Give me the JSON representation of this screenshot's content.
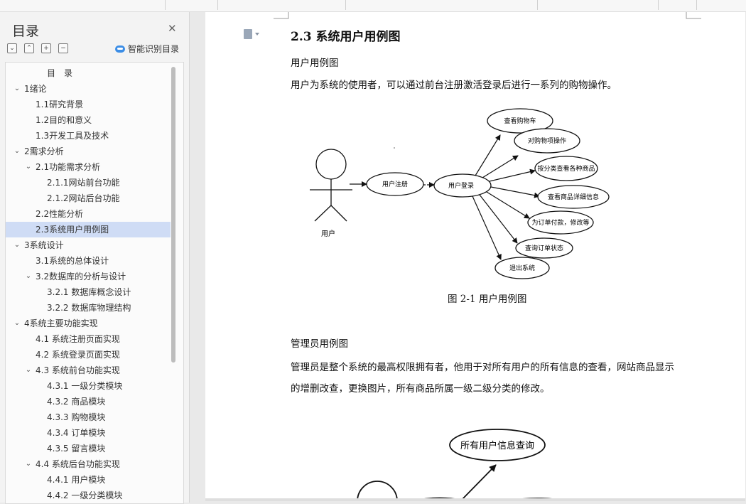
{
  "nav": {
    "title": "目录",
    "smart_toc_label": "智能识别目录",
    "items": [
      {
        "label": "目　录",
        "level": 0,
        "expandable": false
      },
      {
        "label": "1绪论",
        "level": 1,
        "expandable": true
      },
      {
        "label": "1.1研究背景",
        "level": 2,
        "expandable": false
      },
      {
        "label": "1.2目的和意义",
        "level": 2,
        "expandable": false
      },
      {
        "label": "1.3开发工具及技术",
        "level": 2,
        "expandable": false
      },
      {
        "label": "2需求分析",
        "level": 1,
        "expandable": true
      },
      {
        "label": "2.1功能需求分析",
        "level": 2,
        "expandable": true
      },
      {
        "label": "2.1.1网站前台功能",
        "level": 3,
        "expandable": false
      },
      {
        "label": "2.1.2网站后台功能",
        "level": 3,
        "expandable": false
      },
      {
        "label": "2.2性能分析",
        "level": 2,
        "expandable": false
      },
      {
        "label": "2.3系统用户用例图",
        "level": 2,
        "expandable": false,
        "selected": true
      },
      {
        "label": "3系统设计",
        "level": 1,
        "expandable": true
      },
      {
        "label": "3.1系统的总体设计",
        "level": 2,
        "expandable": false
      },
      {
        "label": "3.2数据库的分析与设计",
        "level": 2,
        "expandable": true
      },
      {
        "label": "3.2.1 数据库概念设计",
        "level": 3,
        "expandable": false
      },
      {
        "label": "3.2.2 数据库物理结构",
        "level": 3,
        "expandable": false
      },
      {
        "label": "4系统主要功能实现",
        "level": 1,
        "expandable": true
      },
      {
        "label": "4.1  系统注册页面实现",
        "level": 2,
        "expandable": false
      },
      {
        "label": "4.2  系统登录页面实现",
        "level": 2,
        "expandable": false
      },
      {
        "label": "4.3 系统前台功能实现",
        "level": 2,
        "expandable": true
      },
      {
        "label": "4.3.1 一级分类模块",
        "level": 3,
        "expandable": false
      },
      {
        "label": "4.3.2 商品模块",
        "level": 3,
        "expandable": false
      },
      {
        "label": "4.3.3 购物模块",
        "level": 3,
        "expandable": false
      },
      {
        "label": "4.3.4 订单模块",
        "level": 3,
        "expandable": false
      },
      {
        "label": "4.3.5 留言模块",
        "level": 3,
        "expandable": false
      },
      {
        "label": "4.4 系统后台功能实现",
        "level": 2,
        "expandable": true
      },
      {
        "label": "4.4.1 用户模块",
        "level": 3,
        "expandable": false
      },
      {
        "label": "4.4.2 一级分类模块",
        "level": 3,
        "expandable": false
      }
    ]
  },
  "document": {
    "heading": "2.3  系统用户用例图",
    "user_subtitle": "用户用例图",
    "user_paragraph": "用户为系统的使用者，可以通过前台注册激活登录后进行一系列的购物操作。",
    "figure_caption": "图 2-1 用户用例图",
    "admin_subtitle": "管理员用例图",
    "admin_paragraph_1": "管理员是整个系统的最高权限拥有者，他用于对所有用户的所有信息的查看，网站商品显示",
    "admin_paragraph_2": "的增删改查，更换图片，所有商品所属一级二级分类的修改。"
  },
  "diagram_user": {
    "actor": "用户",
    "register": "用户注册",
    "login": "用户登录",
    "use_cases": [
      "查看购物车",
      "对购物项操作",
      "按分类查看各种商品",
      "查看商品详细信息",
      "为订单付款，修改等",
      "查询订单状态",
      "退出系统"
    ]
  },
  "diagram_admin": {
    "use_case_top": "所有用户信息查询"
  }
}
